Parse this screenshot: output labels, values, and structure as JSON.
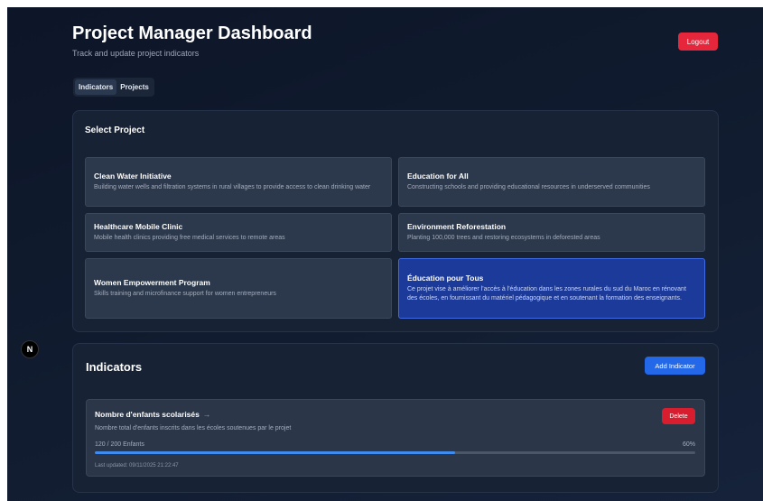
{
  "header": {
    "title": "Project Manager Dashboard",
    "subtitle": "Track and update project indicators",
    "logout_label": "Logout"
  },
  "tabs": [
    {
      "label": "Indicators",
      "active": true
    },
    {
      "label": "Projects",
      "active": false
    }
  ],
  "select_project": {
    "title": "Select Project",
    "projects": [
      {
        "name": "Clean Water Initiative",
        "description": "Building water wells and filtration systems in rural villages to provide access to clean drinking water"
      },
      {
        "name": "Education for All",
        "description": "Constructing schools and providing educational resources in underserved communities"
      },
      {
        "name": "Healthcare Mobile Clinic",
        "description": "Mobile health clinics providing free medical services to remote areas"
      },
      {
        "name": "Environment Reforestation",
        "description": "Planting 100,000 trees and restoring ecosystems in deforested areas"
      },
      {
        "name": "Women Empowerment Program",
        "description": "Skills training and microfinance support for women entrepreneurs"
      },
      {
        "name": "Éducation pour Tous",
        "description": "Ce projet vise à améliorer l'accès à l'éducation dans les zones rurales du sud du Maroc en rénovant des écoles, en fournissant du matériel pédagogique et en soutenant la formation des enseignants.",
        "selected": true
      }
    ]
  },
  "indicators": {
    "title": "Indicators",
    "add_label": "Add Indicator",
    "items": [
      {
        "name": "Nombre d'enfants scolarisés",
        "arrow": "→",
        "description": "Nombre total d'enfants inscrits dans les écoles soutenues par le projet",
        "progress_text": "120 / 200 Enfants",
        "percent_label": "60%",
        "progress_fraction": 0.6,
        "last_updated": "Last updated: 09/11/2025 21:22:47",
        "delete_label": "Delete"
      }
    ]
  },
  "badge": {
    "letter": "N"
  },
  "colors": {
    "accent_blue": "#2368e8",
    "danger_red": "#e5263b",
    "selected_card": "#1c3a9a",
    "progress_fill": "#3f8bf0"
  }
}
